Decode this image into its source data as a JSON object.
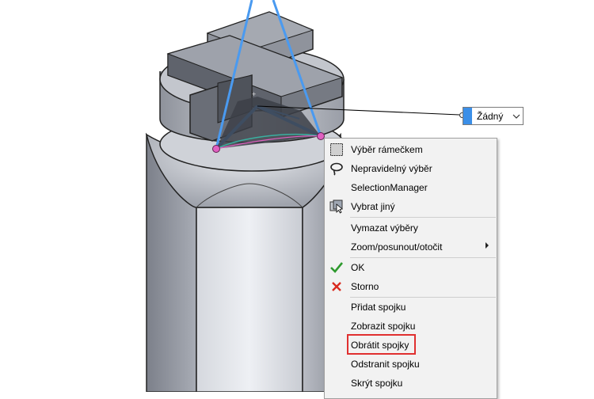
{
  "selection_box": {
    "value": "Žádný"
  },
  "context_menu": {
    "items": [
      {
        "id": "box",
        "label": "Výběr rámečkem",
        "icon": "box-select-icon"
      },
      {
        "id": "lasso",
        "label": "Nepravidelný výběr",
        "icon": "lasso-icon"
      },
      {
        "id": "selmgr",
        "label": "SelectionManager",
        "icon": ""
      },
      {
        "id": "other",
        "label": "Vybrat jiný",
        "icon": "select-other-icon"
      },
      {
        "id": "clear",
        "label": "Vymazat výběry",
        "icon": ""
      },
      {
        "id": "zoom",
        "label": "Zoom/posunout/otočit",
        "icon": "",
        "submenu": true
      },
      {
        "id": "ok",
        "label": "OK",
        "icon": "check-icon"
      },
      {
        "id": "cancel",
        "label": "Storno",
        "icon": "cross-icon"
      },
      {
        "id": "add",
        "label": "Přidat spojku",
        "icon": ""
      },
      {
        "id": "show",
        "label": "Zobrazit spojku",
        "icon": ""
      },
      {
        "id": "flip",
        "label": "Obrátit spojky",
        "icon": "",
        "highlighted": true
      },
      {
        "id": "remove",
        "label": "Odstranit spojku",
        "icon": ""
      },
      {
        "id": "hide",
        "label": "Skrýt spojku",
        "icon": ""
      }
    ]
  },
  "colors": {
    "accent": "#3b8fe8",
    "highlight": "#e03030",
    "ok_green": "#2e9a2e",
    "cancel_red": "#d92a1f",
    "preview_blue": "#4a9af0",
    "point_pink": "#e060c0"
  }
}
